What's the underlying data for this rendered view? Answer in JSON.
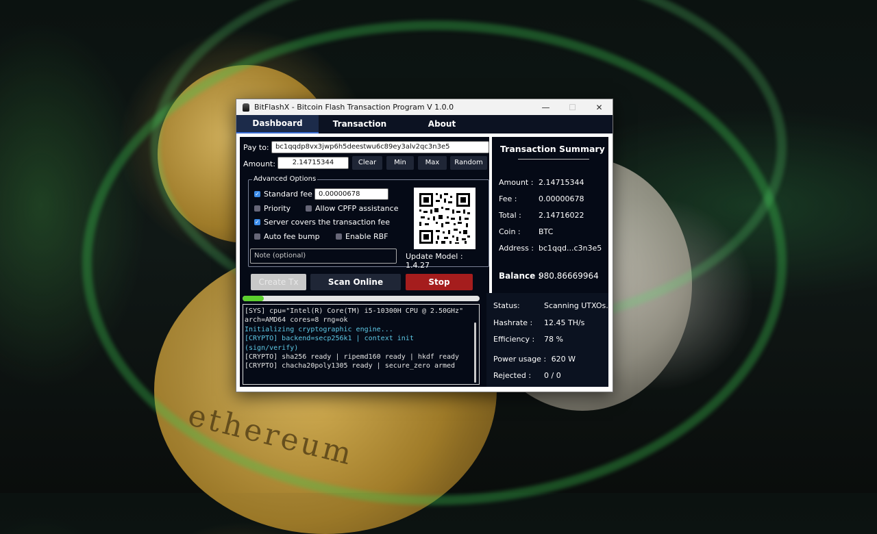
{
  "window": {
    "title": "BitFlashX - Bitcoin Flash Transaction Program V 1.0.0",
    "controls": {
      "minimize": "—",
      "maximize": "☐",
      "close": "✕"
    }
  },
  "tabs": [
    {
      "label": "Dashboard",
      "active": true
    },
    {
      "label": "Transaction",
      "active": false
    },
    {
      "label": "About",
      "active": false
    }
  ],
  "form": {
    "pay_to_label": "Pay to:",
    "pay_to_value": "bc1qqdp8vx3jwp6h5deestwu6c89ey3alv2qc3n3e5",
    "amount_label": "Amount:",
    "amount_value": "2.14715344",
    "buttons": {
      "clear": "Clear",
      "min": "Min",
      "max": "Max",
      "random": "Random"
    }
  },
  "advanced": {
    "title": "Advanced Options",
    "standard_fee": {
      "label": "Standard fee",
      "checked": true,
      "value": "0.00000678"
    },
    "priority": {
      "label": "Priority",
      "checked": false
    },
    "allow_cpfp": {
      "label": "Allow CPFP assistance",
      "checked": false
    },
    "server_covers": {
      "label": "Server covers the transaction fee",
      "checked": true
    },
    "auto_fee_bump": {
      "label": "Auto fee bump",
      "checked": false
    },
    "enable_rbf": {
      "label": "Enable RBF",
      "checked": false
    },
    "note_placeholder": "Note (optional)",
    "update_model": "Update Model : 1.4.27"
  },
  "actions": {
    "create_tx": "Create Tx",
    "scan_online": "Scan Online",
    "stop": "Stop"
  },
  "progress": {
    "percent": 9
  },
  "console": [
    {
      "text": "[SYS] cpu=\"Intel(R) Core(TM) i5-10300H CPU @ 2.50GHz\" arch=AMD64 cores=8 rng=ok",
      "type": "normal"
    },
    {
      "text": "Initializing cryptographic engine...",
      "type": "info"
    },
    {
      "text": "[CRYPTO] backend=secp256k1 | context init (sign/verify)",
      "type": "info"
    },
    {
      "text": "[CRYPTO] sha256 ready | ripemd160 ready | hkdf ready",
      "type": "normal"
    },
    {
      "text": "[CRYPTO] chacha20poly1305 ready | secure_zero armed",
      "type": "normal"
    }
  ],
  "summary": {
    "title": "Transaction Summary",
    "amount_label": "Amount :",
    "amount": "2.14715344",
    "fee_label": "Fee :",
    "fee": "0.00000678",
    "total_label": "Total :",
    "total": "2.14716022",
    "coin_label": "Coin :",
    "coin": "BTC",
    "address_label": "Address :",
    "address": "bc1qqd...c3n3e5",
    "balance_label": "Balance :",
    "balance": "980.86669964"
  },
  "stats": {
    "status_label": "Status:",
    "status": "Scanning UTXOs...",
    "hashrate_label": "Hashrate :",
    "hashrate": "12.45 TH/s",
    "efficiency_label": "Efficiency :",
    "efficiency": "78 %",
    "power_label": "Power usage :",
    "power": "620 W",
    "rejected_label": "Rejected :",
    "rejected": "0 / 0"
  },
  "background": {
    "coin_text": "ethereum"
  }
}
